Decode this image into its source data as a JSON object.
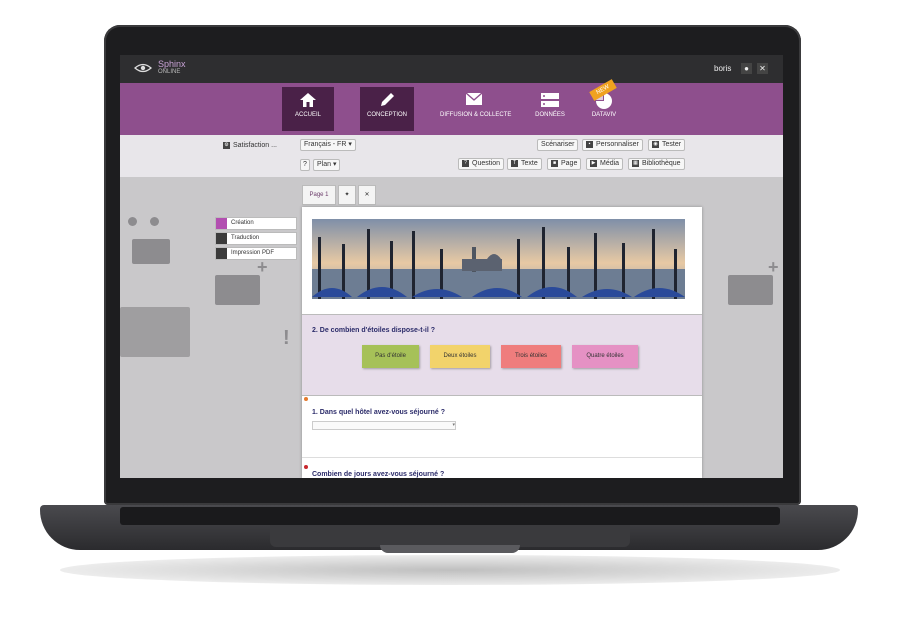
{
  "app": {
    "logo_name": "Sphinx",
    "logo_sub": "ONLINE",
    "user": "boris"
  },
  "nav": {
    "items": [
      {
        "label": "ACCUEIL",
        "icon": "home-icon"
      },
      {
        "label": "CONCEPTION",
        "icon": "pencil-icon"
      },
      {
        "label": "DIFFUSION & COLLECTE",
        "icon": "mail-icon"
      },
      {
        "label": "DONNÉES",
        "icon": "database-icon"
      },
      {
        "label": "DATAVIV",
        "icon": "pie-chart-icon"
      }
    ],
    "badge": "NEW"
  },
  "toolbar": {
    "survey_name": "Satisfaction ...",
    "language_select": "Français - FR",
    "theme_select": "Plan",
    "scenario": "Scénariser",
    "personalize": "Personnaliser",
    "test": "Tester",
    "question": "Question",
    "text": "Texte",
    "page": "Page",
    "media": "Média",
    "library": "Bibliothèque"
  },
  "legend": {
    "items": [
      {
        "label": "Création",
        "color": "#b24fb0"
      },
      {
        "label": "Traduction",
        "color": "#3b3b3b"
      },
      {
        "label": "Impression PDF",
        "color": "#3b3b3b"
      }
    ]
  },
  "page": {
    "tab_label": "Page 1",
    "q2": {
      "title": "2. De combien d'étoiles dispose-t-il ?",
      "options": [
        {
          "label": "Pas d'étoile",
          "color": "#a6c158"
        },
        {
          "label": "Deux étoiles",
          "color": "#f2d36b"
        },
        {
          "label": "Trois étoiles",
          "color": "#ef7d7d"
        },
        {
          "label": "Quatre étoiles",
          "color": "#e591c4"
        }
      ]
    },
    "q1": {
      "title": "1. Dans quel hôtel avez-vous séjourné ?",
      "input_arrow": "▾"
    },
    "q3": {
      "title": "Combien de jours avez-vous séjourné ?"
    }
  }
}
